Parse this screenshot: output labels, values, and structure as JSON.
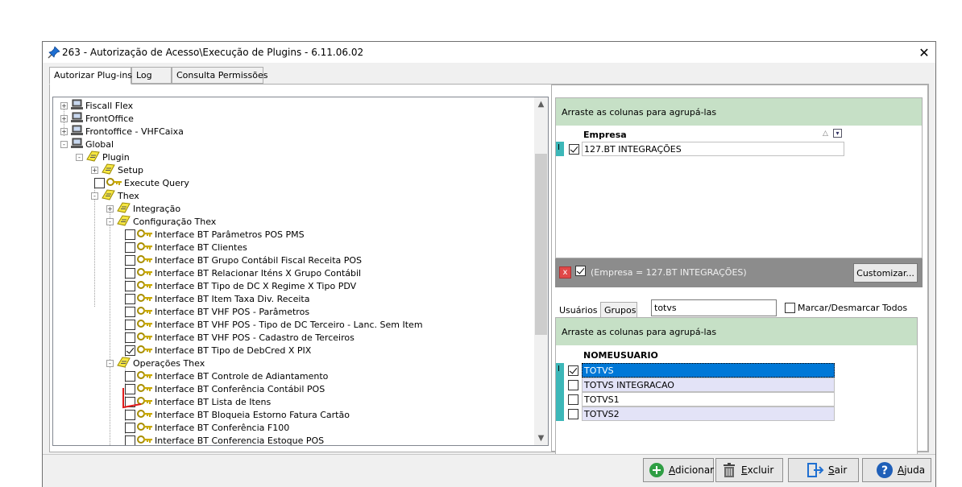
{
  "window": {
    "title": "263 - Autorização de Acesso\\Execução de Plugins - 6.11.06.02",
    "close_glyph": "✕"
  },
  "tabs": [
    {
      "label": "Autorizar Plug-ins",
      "active": true
    },
    {
      "label": "Log",
      "active": false
    },
    {
      "label": "Consulta Permissões",
      "active": false
    }
  ],
  "tree": {
    "nodes": [
      {
        "label": "Fiscall Flex",
        "icon": "computer-icon",
        "expander": "+",
        "level": 0
      },
      {
        "label": "FrontOffice",
        "icon": "computer-icon",
        "expander": "+",
        "level": 0
      },
      {
        "label": "Frontoffice - VHFCaixa",
        "icon": "computer-icon",
        "expander": "+",
        "level": 0
      },
      {
        "label": "Global",
        "icon": "computer-icon",
        "expander": "-",
        "level": 0
      },
      {
        "label": "Plugin",
        "icon": "plugin-folder-icon",
        "expander": "-",
        "level": 1
      },
      {
        "label": "Setup",
        "icon": "plugin-folder-icon",
        "expander": "+",
        "level": 2
      },
      {
        "label": "Execute Query",
        "icon": "key-icon",
        "check": false,
        "level": 2
      },
      {
        "label": "Thex",
        "icon": "plugin-folder-icon",
        "expander": "-",
        "level": 2
      },
      {
        "label": "Integração",
        "icon": "plugin-folder-icon",
        "expander": "+",
        "level": 3
      },
      {
        "label": "Configuração Thex",
        "icon": "plugin-folder-icon",
        "expander": "-",
        "level": 3
      },
      {
        "label": "Interface BT Parâmetros POS PMS",
        "icon": "key-icon",
        "check": false,
        "level": 4
      },
      {
        "label": "Interface BT Clientes",
        "icon": "key-icon",
        "check": false,
        "level": 4
      },
      {
        "label": "Interface BT Grupo Contábil Fiscal Receita POS",
        "icon": "key-icon",
        "check": false,
        "level": 4
      },
      {
        "label": "Interface BT Relacionar Iténs X Grupo Contábil",
        "icon": "key-icon",
        "check": false,
        "level": 4
      },
      {
        "label": "Interface BT Tipo de DC X Regime X Tipo PDV",
        "icon": "key-icon",
        "check": false,
        "level": 4
      },
      {
        "label": "Interface BT Item Taxa Div. Receita",
        "icon": "key-icon",
        "check": false,
        "level": 4
      },
      {
        "label": "Interface BT VHF POS - Parâmetros",
        "icon": "key-icon",
        "check": false,
        "level": 4
      },
      {
        "label": "Interface BT VHF POS - Tipo de DC Terceiro - Lanc. Sem Item",
        "icon": "key-icon",
        "check": false,
        "level": 4
      },
      {
        "label": "Interface BT VHF POS - Cadastro de Terceiros",
        "icon": "key-icon",
        "check": false,
        "level": 4
      },
      {
        "label": "Interface BT Tipo de DebCred X PIX",
        "icon": "key-icon",
        "check": true,
        "level": 4
      },
      {
        "label": "Operações Thex",
        "icon": "plugin-folder-icon",
        "expander": "-",
        "level": 3
      },
      {
        "label": "Interface BT Controle de Adiantamento",
        "icon": "key-icon",
        "check": false,
        "level": 4
      },
      {
        "label": "Interface BT Conferência Contábil POS",
        "icon": "key-icon",
        "check": false,
        "level": 4
      },
      {
        "label": "Interface BT Lista de Itens",
        "icon": "key-icon",
        "check": false,
        "level": 4
      },
      {
        "label": "Interface BT Bloqueia Estorno Fatura Cartão",
        "icon": "key-icon",
        "check": false,
        "level": 4
      },
      {
        "label": "Interface BT Conferência F100",
        "icon": "key-icon",
        "check": false,
        "level": 4
      },
      {
        "label": "Interface BT Conferencia Estoque POS",
        "icon": "key-icon",
        "check": false,
        "level": 4
      }
    ]
  },
  "empresa_grid": {
    "group_hint": "Arraste as colunas para agrupá-las",
    "column": "Empresa",
    "rows": [
      {
        "label": "127.BT INTEGRAÇÕES",
        "checked": true
      }
    ]
  },
  "filter": {
    "close_glyph": "x",
    "text": "(Empresa = 127.BT INTEGRAÇÕES)",
    "customize_label": "Customizar..."
  },
  "subtabs": [
    {
      "label": "Usuários",
      "active": true
    },
    {
      "label": "Grupos",
      "active": false
    }
  ],
  "search": {
    "value": "totvs"
  },
  "mark_all_label": "Marcar/Desmarcar Todos",
  "users_grid": {
    "group_hint": "Arraste as colunas para agrupá-las",
    "column": "NOMEUSUARIO",
    "rows": [
      {
        "label": "TOTVS",
        "checked": true,
        "selected": true
      },
      {
        "label": "TOTVS INTEGRACAO",
        "checked": false
      },
      {
        "label": "TOTVS1",
        "checked": false
      },
      {
        "label": "TOTVS2",
        "checked": false
      }
    ]
  },
  "buttons": {
    "add": {
      "accel": "A",
      "rest": "dicionar"
    },
    "delete": {
      "accel": "E",
      "rest": "xcluir"
    },
    "exit": {
      "accel": "S",
      "rest": "air"
    },
    "help": {
      "accel": "A",
      "rest": "juda"
    }
  },
  "colors": {
    "group_header": "#c6e0c6",
    "selection": "#0078d7",
    "row_marker": "#3db7b8"
  }
}
